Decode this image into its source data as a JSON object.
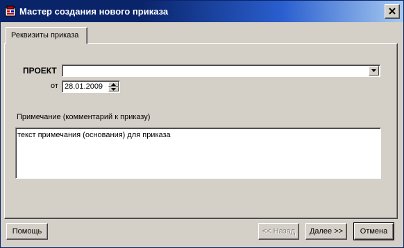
{
  "window": {
    "title": "Мастер создания нового приказа",
    "icon": "app-document-icon"
  },
  "tabs": [
    {
      "label": "Реквизиты приказа",
      "active": true
    }
  ],
  "form": {
    "project_label": "ПРОЕКТ",
    "project_value": "",
    "from_label": "от",
    "date_value": "28.01.2009",
    "note_label": "Примечание (комментарий к приказу)",
    "note_value": "текст примечания (основания) для приказа"
  },
  "buttons": {
    "help": "Помощь",
    "back": "<< Назад",
    "next": "Далее >>",
    "cancel": "Отмена"
  }
}
